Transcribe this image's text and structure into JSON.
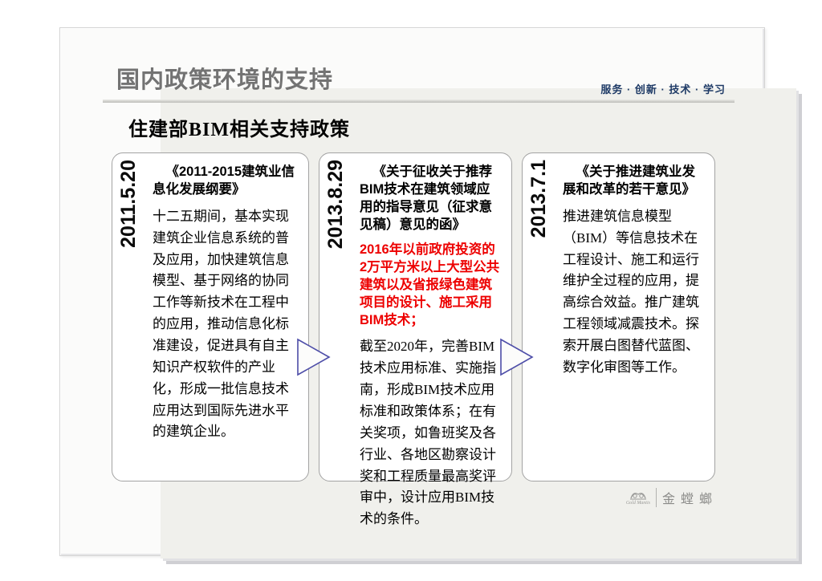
{
  "slide": {
    "title": "国内政策环境的支持",
    "slogan": "服务 · 创新 · 技术 · 学习",
    "subtitle": "住建部BIM相关支持政策",
    "cards": [
      {
        "date": "2011.5.20",
        "title": "《2011-2015建筑业信息化发展纲要》",
        "body": "十二五期间，基本实现建筑企业信息系统的普及应用，加快建筑信息模型、基于网络的协同工作等新技术在工程中的应用，推动信息化标准建设，促进具有自主知识产权软件的产业化，形成一批信息技术应用达到国际先进水平的建筑企业。"
      },
      {
        "date": "2013.8.29",
        "title": "《关于征收关于推荐BIM技术在建筑领域应用的指导意见（征求意见稿）意见的函》",
        "highlight": "2016年以前政府投资的2万平方米以上大型公共建筑以及省报绿色建筑项目的设计、施工采用BIM技术；",
        "body": "截至2020年，完善BIM技术应用标准、实施指南，形成BIM技术应用标准和政策体系；在有关奖项，如鲁班奖及各行业、各地区勘察设计奖和工程质量最高奖评审中，设计应用BIM技术的条件。"
      },
      {
        "date": "2013.7.1",
        "title": "《关于推进建筑业发展和改革的若干意见》",
        "body": "推进建筑信息模型（BIM）等信息技术在工程设计、施工和运行维护全过程的应用，提高综合效益。推广建筑工程领域减震技术。探索开展白图替代蓝图、数字化审图等工作。"
      }
    ],
    "logo": {
      "cn": "金螳螂",
      "sub": "Gold Mantis"
    },
    "colors": {
      "content_bg": "#f0f0ec",
      "title_gray": "#737373",
      "slogan_navy": "#1e3a66",
      "highlight_red": "#ed0000",
      "arrow_purple": "#4d4da8",
      "card_border": "#a3a3a3",
      "logo_gray": "#8b8b89"
    }
  }
}
